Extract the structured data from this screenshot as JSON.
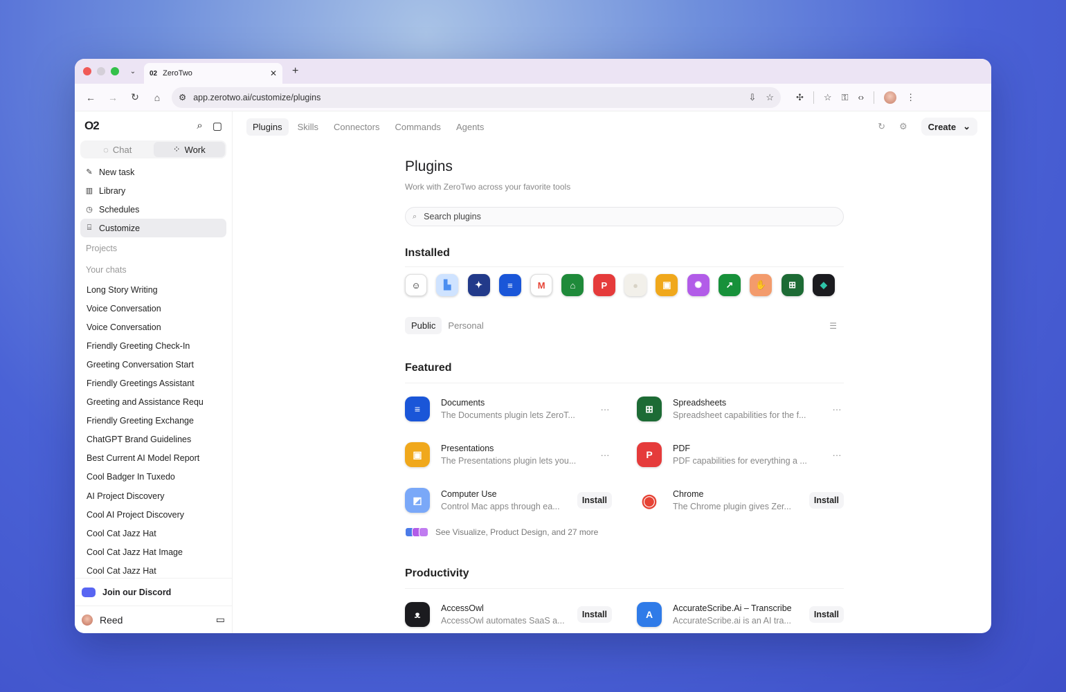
{
  "browser": {
    "tab_title": "ZeroTwo",
    "tab_logo": "02",
    "url": "app.zerotwo.ai/customize/plugins"
  },
  "sidebar": {
    "logo": "O2",
    "mode_chat": "Chat",
    "mode_work": "Work",
    "nav": [
      {
        "label": "New task",
        "icon": "edit-icon"
      },
      {
        "label": "Library",
        "icon": "library-icon"
      },
      {
        "label": "Schedules",
        "icon": "clock-icon"
      },
      {
        "label": "Customize",
        "icon": "briefcase-icon"
      }
    ],
    "projects_label": "Projects",
    "your_chats_label": "Your chats",
    "chats": [
      "Long Story Writing",
      "Voice Conversation",
      "Voice Conversation",
      "Friendly Greeting Check-In",
      "Greeting Conversation Start",
      "Friendly Greetings Assistant",
      "Greeting and Assistance Requ",
      "Friendly Greeting Exchange",
      "ChatGPT Brand Guidelines",
      "Best Current AI Model Report",
      "Cool Badger In Tuxedo",
      "AI Project Discovery",
      "Cool AI Project Discovery",
      "Cool Cat Jazz Hat",
      "Cool Cat Jazz Hat Image",
      "Cool Cat Jazz Hat"
    ],
    "discord_label": "Join our Discord",
    "user_name": "Reed"
  },
  "topnav": {
    "tabs": [
      "Plugins",
      "Skills",
      "Connectors",
      "Commands",
      "Agents"
    ],
    "create_label": "Create"
  },
  "page": {
    "title": "Plugins",
    "subtitle": "Work with ZeroTwo across your favorite tools",
    "search_placeholder": "Search plugins",
    "installed_label": "Installed",
    "filter_public": "Public",
    "filter_personal": "Personal",
    "featured_label": "Featured",
    "see_more": "See Visualize, Product Design, and 27 more",
    "productivity_label": "Productivity",
    "install_label": "Install",
    "more_label": "···"
  },
  "installed_icons": [
    {
      "name": "robot-face-icon",
      "glyph": "☺",
      "color": "#ffffff",
      "fg": "#111"
    },
    {
      "name": "blocks-icon",
      "glyph": "▙",
      "color": "#cfe3ff",
      "fg": "#4b8ef0"
    },
    {
      "name": "compass-icon",
      "glyph": "✦",
      "color": "#223a8a",
      "fg": "#fff"
    },
    {
      "name": "docs-icon",
      "glyph": "≡",
      "color": "#1a56d8",
      "fg": "#fff"
    },
    {
      "name": "gmail-icon",
      "glyph": "M",
      "color": "#ffffff",
      "fg": "#e64335"
    },
    {
      "name": "bank-icon",
      "glyph": "⌂",
      "color": "#1f8a3a",
      "fg": "#fff"
    },
    {
      "name": "pdf-icon",
      "glyph": "P",
      "color": "#e53b3b",
      "fg": "#fff"
    },
    {
      "name": "egg-icon",
      "glyph": "●",
      "color": "#f2f0ea",
      "fg": "#d8d3c6"
    },
    {
      "name": "slides-icon",
      "glyph": "▣",
      "color": "#f0a81c",
      "fg": "#fff"
    },
    {
      "name": "nodes-icon",
      "glyph": "✺",
      "color": "#b25ce8",
      "fg": "#fff"
    },
    {
      "name": "chart-icon",
      "glyph": "↗",
      "color": "#17913a",
      "fg": "#fff"
    },
    {
      "name": "handshake-icon",
      "glyph": "✋",
      "color": "#f39b6c",
      "fg": "#fff"
    },
    {
      "name": "sheet-icon",
      "glyph": "⊞",
      "color": "#1d6b35",
      "fg": "#fff"
    },
    {
      "name": "diamond-icon",
      "glyph": "◆",
      "color": "#1b1b1f",
      "fg": "#2ec4a8"
    }
  ],
  "featured": [
    {
      "name": "Documents",
      "desc": "The Documents plugin lets ZeroT...",
      "action": "more",
      "icon": "docs-icon",
      "glyph": "≡",
      "color": "#1a56d8"
    },
    {
      "name": "Spreadsheets",
      "desc": "Spreadsheet capabilities for the f...",
      "action": "more",
      "icon": "sheet-icon",
      "glyph": "⊞",
      "color": "#1d6b35"
    },
    {
      "name": "Presentations",
      "desc": "The Presentations plugin lets you...",
      "action": "more",
      "icon": "slides-icon",
      "glyph": "▣",
      "color": "#f0a81c"
    },
    {
      "name": "PDF",
      "desc": "PDF capabilities for everything a ...",
      "action": "more",
      "icon": "pdf-icon",
      "glyph": "P",
      "color": "#e53b3b"
    },
    {
      "name": "Computer Use",
      "desc": "Control Mac apps through ea...",
      "action": "install",
      "icon": "cursor-icon",
      "glyph": "◩",
      "color": "#7aa8f8"
    },
    {
      "name": "Chrome",
      "desc": "The Chrome plugin gives Zer...",
      "action": "install",
      "icon": "chrome-icon",
      "glyph": "◉",
      "color": "#ffffff"
    }
  ],
  "productivity": [
    {
      "name": "AccessOwl",
      "desc": "AccessOwl automates SaaS a...",
      "action": "install",
      "icon": "owl-icon",
      "glyph": "ᴥ",
      "color": "#1b1b1f"
    },
    {
      "name": "AccurateScribe.Ai – Transcribe",
      "desc": "AccurateScribe.ai is an AI tra...",
      "action": "install",
      "icon": "scribe-icon",
      "glyph": "A",
      "color": "#2f7be8"
    }
  ],
  "colors": {
    "accent": "#1f1f22",
    "discord": "#5865f2"
  }
}
